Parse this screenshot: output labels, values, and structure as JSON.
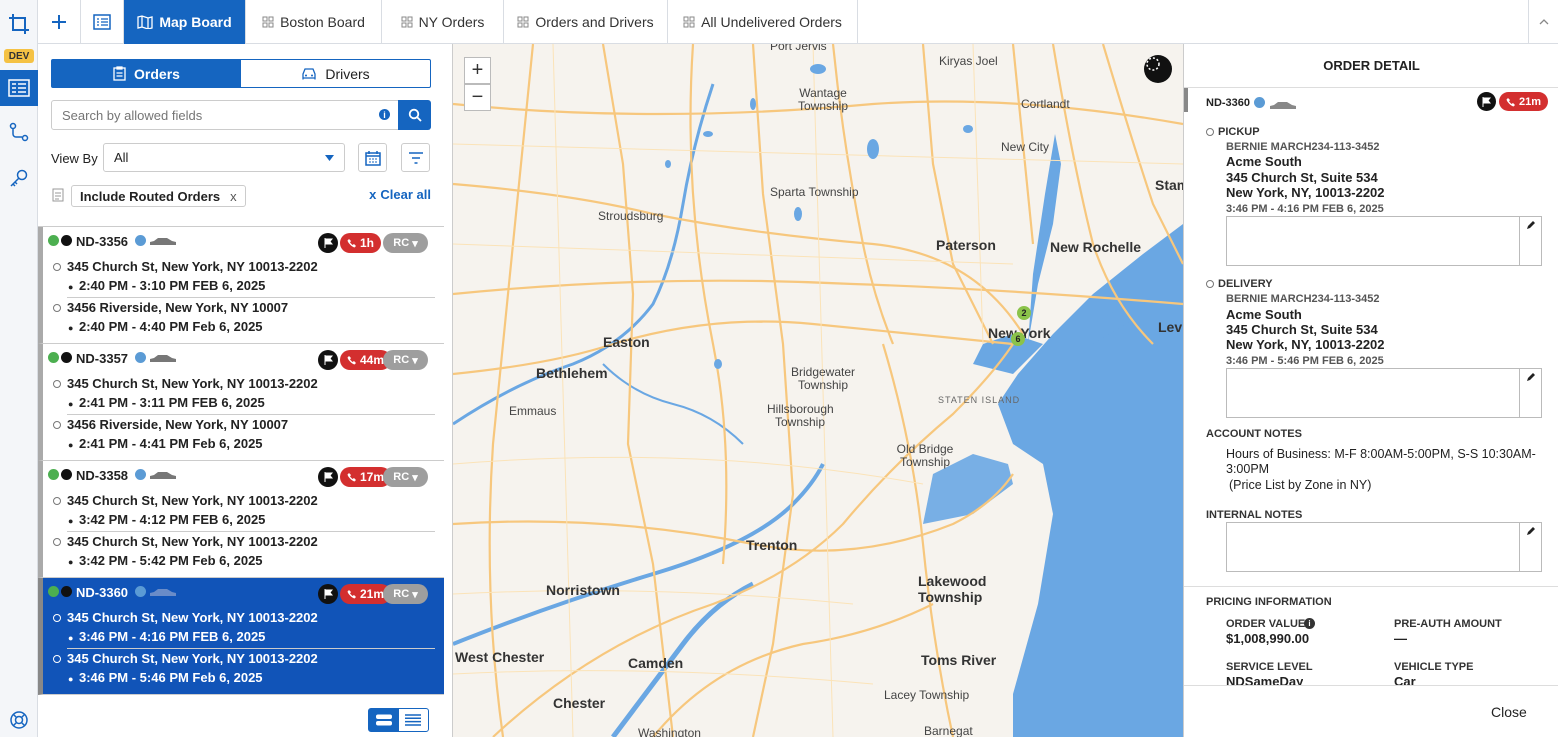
{
  "rail": {
    "dev_badge": "DEV"
  },
  "topbar": {
    "tabs": [
      {
        "label": "Map Board",
        "active": true
      },
      {
        "label": "Boston Board"
      },
      {
        "label": "NY Orders"
      },
      {
        "label": "Orders and Drivers"
      },
      {
        "label": "All Undelivered Orders"
      }
    ]
  },
  "left": {
    "toggle_orders": "Orders",
    "toggle_drivers": "Drivers",
    "search_placeholder": "Search by allowed fields",
    "view_by_label": "View By",
    "view_by_value": "All",
    "chip_label": "Include Routed Orders",
    "chip_remove": "x",
    "clear_all": "Clear all",
    "orders": [
      {
        "id": "ND-3356",
        "time": "1h",
        "rc": "RC",
        "pickup_addr": "345 Church St, New York, NY 10013-2202",
        "pickup_time": "2:40 PM - 3:10 PM FEB 6, 2025",
        "drop_addr": "3456 Riverside, New York, NY 10007",
        "drop_time": "2:40 PM - 4:40 PM Feb 6, 2025"
      },
      {
        "id": "ND-3357",
        "time": "44m",
        "rc": "RC",
        "pickup_addr": "345 Church St, New York, NY 10013-2202",
        "pickup_time": "2:41 PM - 3:11 PM FEB 6, 2025",
        "drop_addr": "3456 Riverside, New York, NY 10007",
        "drop_time": "2:41 PM - 4:41 PM Feb 6, 2025"
      },
      {
        "id": "ND-3358",
        "time": "17m",
        "rc": "RC",
        "pickup_addr": "345 Church St, New York, NY 10013-2202",
        "pickup_time": "3:42 PM - 4:12 PM FEB 6, 2025",
        "drop_addr": "345 Church St, New York, NY 10013-2202",
        "drop_time": "3:42 PM - 5:42 PM Feb 6, 2025"
      },
      {
        "id": "ND-3360",
        "time": "21m",
        "rc": "RC",
        "pickup_addr": "345 Church St, New York, NY 10013-2202",
        "pickup_time": "3:46 PM - 4:16 PM FEB 6, 2025",
        "drop_addr": "345 Church St, New York, NY 10013-2202",
        "drop_time": "3:46 PM - 5:46 PM Feb 6, 2025",
        "selected": true
      }
    ]
  },
  "map": {
    "zoom_in": "+",
    "zoom_out": "−",
    "cluster_a": "2",
    "cluster_b": "6",
    "places": [
      "Port Jervis",
      "Kiryas Joel",
      "Wantage Township",
      "Cortlandt",
      "New City",
      "Sparta Township",
      "Stroudsburg",
      "Paterson",
      "New Rochelle",
      "Stamford",
      "New York",
      "Easton",
      "Bethlehem",
      "Bridgewater Township",
      "Emmaus",
      "Hillsborough Township",
      "Old Bridge Township",
      "Levittown",
      "Trenton",
      "Norristown",
      "Lakewood Township",
      "West Chester",
      "Camden",
      "Toms River",
      "Chester",
      "Lacey Township",
      "Washington",
      "Barnegat",
      "STATEN ISLAND"
    ]
  },
  "detail": {
    "title": "ORDER DETAIL",
    "order_id": "ND-3360",
    "time": "21m",
    "pickup": {
      "label": "PICKUP",
      "contact": "BERNIE MARCH234-113-3452",
      "name": "Acme South",
      "street": "345 Church St, Suite 534",
      "city": "New York, NY, 10013-2202",
      "window": "3:46 PM - 4:16 PM FEB 6, 2025"
    },
    "delivery": {
      "label": "DELIVERY",
      "contact": "BERNIE MARCH234-113-3452",
      "name": "Acme South",
      "street": "345 Church St, Suite 534",
      "city": "New York, NY, 10013-2202",
      "window": "3:46 PM - 5:46 PM FEB 6, 2025"
    },
    "account_notes_label": "ACCOUNT NOTES",
    "account_notes_line1": "Hours of Business: M-F 8:00AM-5:00PM, S-S 10:30AM-",
    "account_notes_line2": "3:00PM",
    "account_notes_line3": "(Price List by Zone in NY)",
    "internal_notes_label": "INTERNAL NOTES",
    "pricing_label": "PRICING INFORMATION",
    "order_value_label": "ORDER VALUE",
    "order_value": "$1,008,990.00",
    "preauth_label": "PRE-AUTH AMOUNT",
    "preauth_value": "—",
    "service_level_label": "SERVICE LEVEL",
    "service_level": "NDSameDay",
    "vehicle_type_label": "VEHICLE TYPE",
    "vehicle_type": "Car",
    "close": "Close"
  },
  "colors": {
    "primary": "#1565c0",
    "danger": "#d32f2f",
    "water": "#6aa7e3",
    "road": "#f7c77d"
  }
}
